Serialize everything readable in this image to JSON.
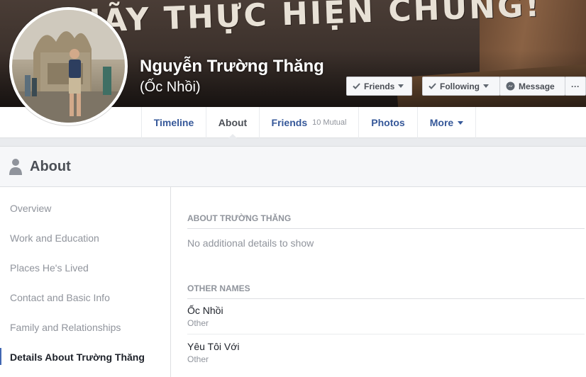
{
  "cover": {
    "text": "HÃY THỰC HIỆN CHUNG!"
  },
  "profile": {
    "name": "Nguyễn Trường Thăng",
    "alternate_name": "(Ốc Nhồi)"
  },
  "actions": {
    "friends": "Friends",
    "following": "Following",
    "message": "Message",
    "more": "···"
  },
  "tabs": [
    {
      "label": "Timeline"
    },
    {
      "label": "About"
    },
    {
      "label": "Friends",
      "badge": "10 Mutual"
    },
    {
      "label": "Photos"
    },
    {
      "label": "More"
    }
  ],
  "about": {
    "title": "About",
    "sidebar": [
      "Overview",
      "Work and Education",
      "Places He's Lived",
      "Contact and Basic Info",
      "Family and Relationships",
      "Details About Trường Thăng"
    ],
    "section_about": {
      "heading": "ABOUT TRƯỜNG THĂNG",
      "empty_text": "No additional details to show"
    },
    "section_other_names": {
      "heading": "OTHER NAMES",
      "names": [
        {
          "name": "Ốc Nhồi",
          "type": "Other"
        },
        {
          "name": "Yêu Tôi Với",
          "type": "Other"
        }
      ]
    }
  },
  "colors": {
    "link_blue": "#365899",
    "accent_blue": "#4267b2",
    "muted_gray": "#90949c",
    "page_bg": "#e9ebee"
  }
}
